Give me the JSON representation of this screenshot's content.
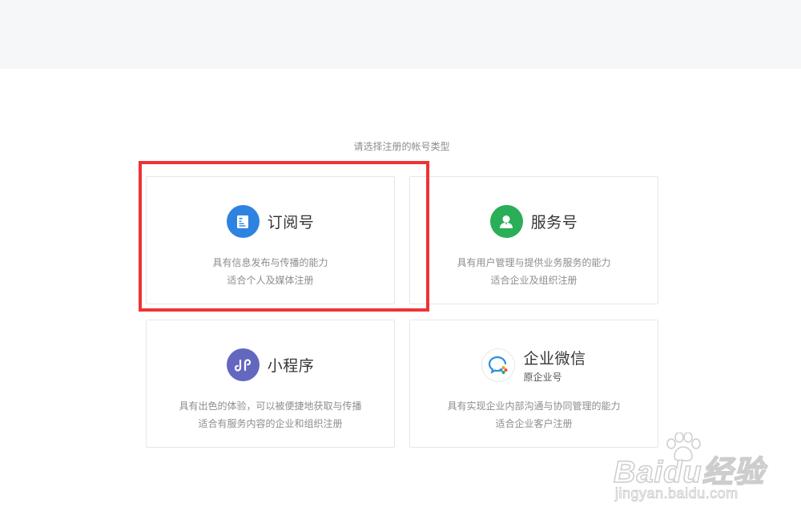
{
  "prompt": "请选择注册的帐号类型",
  "cards": [
    {
      "title": "订阅号",
      "subname": "",
      "icon": "subscription-doc-icon",
      "icon_color": "#2e83e0",
      "desc_line1": "具有信息发布与传播的能力",
      "desc_line2": "适合个人及媒体注册"
    },
    {
      "title": "服务号",
      "subname": "",
      "icon": "service-person-icon",
      "icon_color": "#2aae57",
      "desc_line1": "具有用户管理与提供业务服务的能力",
      "desc_line2": "适合企业及组织注册"
    },
    {
      "title": "小程序",
      "subname": "",
      "icon": "mini-program-icon",
      "icon_color": "#6467c0",
      "desc_line1": "具有出色的体验，可以被便捷地获取与传播",
      "desc_line2": "适合有服务内容的企业和组织注册"
    },
    {
      "title": "企业微信",
      "subname": "原企业号",
      "icon": "wecom-chat-icon",
      "icon_color": "#2d8fe0",
      "desc_line1": "具有实现企业内部沟通与协同管理的能力",
      "desc_line2": "适合企业客户注册"
    }
  ],
  "highlight_color": "#ef3335",
  "watermark": {
    "brand": "Baidu经验",
    "url": "jingyan.baidu.com"
  }
}
